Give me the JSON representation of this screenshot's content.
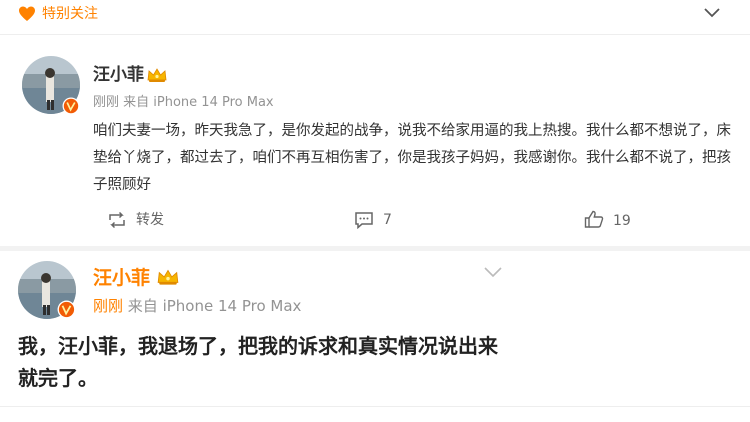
{
  "special_follow": {
    "label": "特别关注"
  },
  "post1": {
    "author": "汪小菲",
    "time": "刚刚",
    "source": "来自 iPhone 14 Pro Max",
    "text": "咱们夫妻一场，昨天我急了，是你发起的战争，说我不给家用逼的我上热搜。我什么都不想说了，床垫给丫烧了，都过去了，咱们不再互相伤害了，你是我孩子妈妈，我感谢你。我什么都不说了，把孩子照顾好",
    "actions": {
      "repost_label": "转发",
      "comment_count": "7",
      "like_count": "19"
    }
  },
  "post2": {
    "author": "汪小菲",
    "time": "刚刚",
    "source": "来自 iPhone 14 Pro Max",
    "text": "我，汪小菲，我退场了，把我的诉求和真实情况说出来就完了。"
  },
  "colors": {
    "accent": "#ff8200",
    "meta": "#939393",
    "verified": "#f25c05"
  },
  "icons": [
    "heart-icon",
    "chevron-down-icon",
    "verified-badge-icon",
    "crown-icon",
    "repost-icon",
    "comment-icon",
    "like-icon"
  ]
}
